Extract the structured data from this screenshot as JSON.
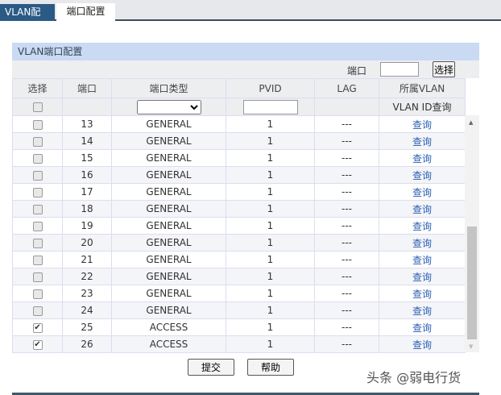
{
  "tabs": [
    "VLAN配置",
    "端口配置"
  ],
  "panel_title": "VLAN端口配置",
  "toolbar": {
    "port_label": "端口",
    "port_value": "",
    "select_button": "选择"
  },
  "columns": [
    "选择",
    "端口",
    "端口类型",
    "PVID",
    "LAG",
    "所属VLAN"
  ],
  "filter": {
    "vlan_query": "VLAN ID查询"
  },
  "rows": [
    {
      "port": "13",
      "type": "GENERAL",
      "pvid": "1",
      "lag": "---",
      "action": "查询",
      "checked": false
    },
    {
      "port": "14",
      "type": "GENERAL",
      "pvid": "1",
      "lag": "---",
      "action": "查询",
      "checked": false
    },
    {
      "port": "15",
      "type": "GENERAL",
      "pvid": "1",
      "lag": "---",
      "action": "查询",
      "checked": false
    },
    {
      "port": "16",
      "type": "GENERAL",
      "pvid": "1",
      "lag": "---",
      "action": "查询",
      "checked": false
    },
    {
      "port": "17",
      "type": "GENERAL",
      "pvid": "1",
      "lag": "---",
      "action": "查询",
      "checked": false
    },
    {
      "port": "18",
      "type": "GENERAL",
      "pvid": "1",
      "lag": "---",
      "action": "查询",
      "checked": false
    },
    {
      "port": "19",
      "type": "GENERAL",
      "pvid": "1",
      "lag": "---",
      "action": "查询",
      "checked": false
    },
    {
      "port": "20",
      "type": "GENERAL",
      "pvid": "1",
      "lag": "---",
      "action": "查询",
      "checked": false
    },
    {
      "port": "21",
      "type": "GENERAL",
      "pvid": "1",
      "lag": "---",
      "action": "查询",
      "checked": false
    },
    {
      "port": "22",
      "type": "GENERAL",
      "pvid": "1",
      "lag": "---",
      "action": "查询",
      "checked": false
    },
    {
      "port": "23",
      "type": "GENERAL",
      "pvid": "1",
      "lag": "---",
      "action": "查询",
      "checked": false
    },
    {
      "port": "24",
      "type": "GENERAL",
      "pvid": "1",
      "lag": "---",
      "action": "查询",
      "checked": false
    },
    {
      "port": "25",
      "type": "ACCESS",
      "pvid": "1",
      "lag": "---",
      "action": "查询",
      "checked": true
    },
    {
      "port": "26",
      "type": "ACCESS",
      "pvid": "1",
      "lag": "---",
      "action": "查询",
      "checked": true
    }
  ],
  "buttons": {
    "submit": "提交",
    "help": "帮助"
  },
  "watermark": "头条 @弱电行货"
}
